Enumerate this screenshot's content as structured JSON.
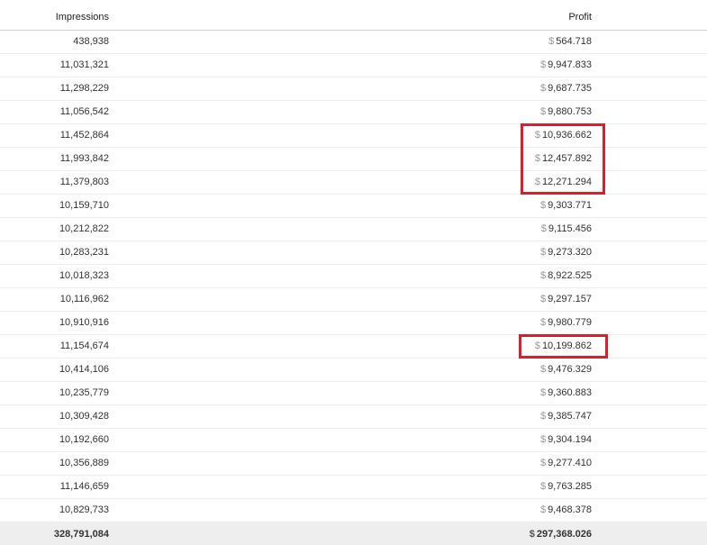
{
  "header": {
    "impressions_label": "Impressions",
    "profit_label": "Profit"
  },
  "currency_symbol": "$",
  "rows": [
    {
      "impressions": "438,938",
      "profit": "564.718"
    },
    {
      "impressions": "11,031,321",
      "profit": "9,947.833"
    },
    {
      "impressions": "11,298,229",
      "profit": "9,687.735"
    },
    {
      "impressions": "11,056,542",
      "profit": "9,880.753"
    },
    {
      "impressions": "11,452,864",
      "profit": "10,936.662"
    },
    {
      "impressions": "11,993,842",
      "profit": "12,457.892"
    },
    {
      "impressions": "11,379,803",
      "profit": "12,271.294"
    },
    {
      "impressions": "10,159,710",
      "profit": "9,303.771"
    },
    {
      "impressions": "10,212,822",
      "profit": "9,115.456"
    },
    {
      "impressions": "10,283,231",
      "profit": "9,273.320"
    },
    {
      "impressions": "10,018,323",
      "profit": "8,922.525"
    },
    {
      "impressions": "10,116,962",
      "profit": "9,297.157"
    },
    {
      "impressions": "10,910,916",
      "profit": "9,980.779"
    },
    {
      "impressions": "11,154,674",
      "profit": "10,199.862"
    },
    {
      "impressions": "10,414,106",
      "profit": "9,476.329"
    },
    {
      "impressions": "10,235,779",
      "profit": "9,360.883"
    },
    {
      "impressions": "10,309,428",
      "profit": "9,385.747"
    },
    {
      "impressions": "10,192,660",
      "profit": "9,304.194"
    },
    {
      "impressions": "10,356,889",
      "profit": "9,277.410"
    },
    {
      "impressions": "11,146,659",
      "profit": "9,763.285"
    },
    {
      "impressions": "10,829,733",
      "profit": "9,468.378"
    }
  ],
  "totals": {
    "impressions": "328,791,084",
    "profit": "297,368.026"
  },
  "highlight_color": "#d6202a"
}
